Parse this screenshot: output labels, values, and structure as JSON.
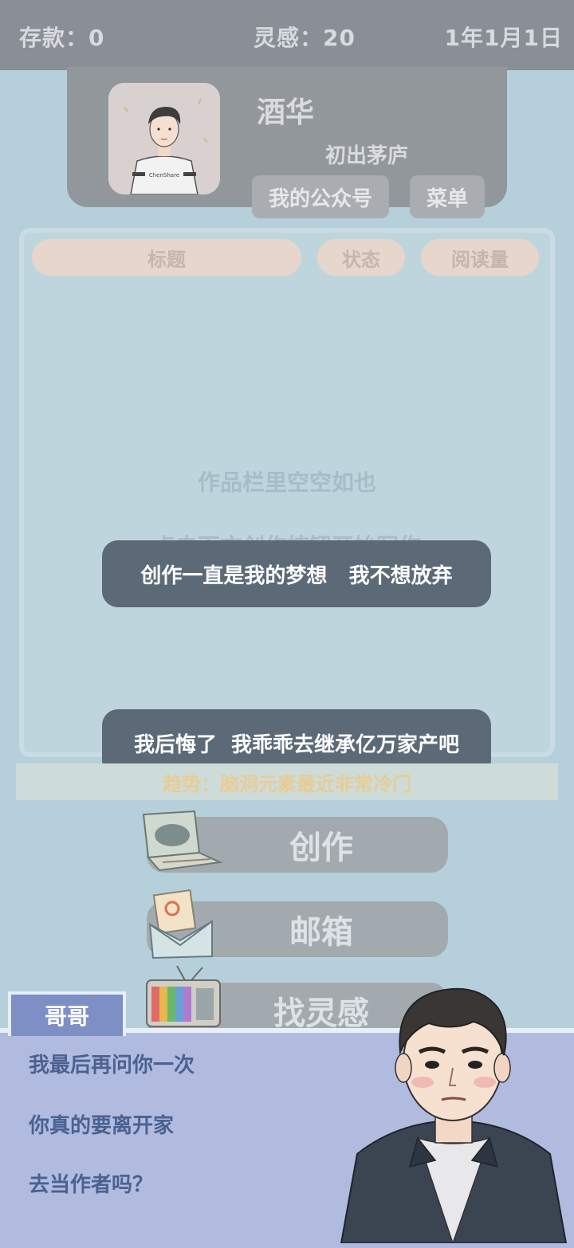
{
  "stats": {
    "money_label": "存款：0",
    "inspiration_label": "灵感：20",
    "date": "1年1月1日"
  },
  "profile": {
    "name": "酒华",
    "level": "初出茅庐",
    "avatar_shirt_text": "ChenShare",
    "account_button": "我的公众号",
    "menu_button": "菜单"
  },
  "works": {
    "columns": [
      "标题",
      "状态",
      "阅读量"
    ],
    "empty_line1": "作品栏里空空如也",
    "empty_line2": "点击下方创作按钮开始写作"
  },
  "choices": [
    "创作一直是我的梦想   我不想放弃",
    "我后悔了  我乖乖去继承亿万家产吧"
  ],
  "trend": "趋势：脑洞元素最近非常冷门",
  "actions": {
    "create": "创作",
    "mailbox": "邮箱",
    "find_inspiration": "找灵感"
  },
  "dialogue": {
    "speaker": "哥哥",
    "lines": [
      "我最后再问你一次",
      "你真的要离开家",
      "去当作者吗？"
    ]
  }
}
